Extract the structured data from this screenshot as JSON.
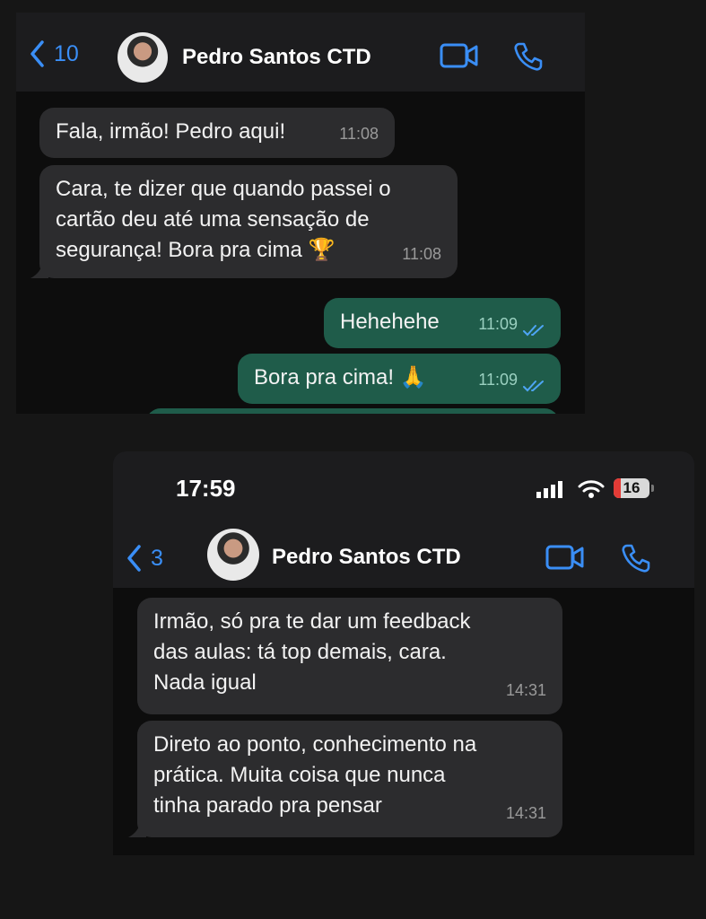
{
  "screenshot1": {
    "header": {
      "back_count": "10",
      "contact_name": "Pedro Santos CTD"
    },
    "messages": [
      {
        "direction": "incoming",
        "text": "Fala, irmão! Pedro aqui!",
        "time": "11:08"
      },
      {
        "direction": "incoming",
        "lines": [
          "Cara, te dizer que quando passei o",
          "cartão deu até uma sensação de",
          "segurança! Bora pra cima 🏆"
        ],
        "time": "11:08"
      },
      {
        "direction": "outgoing",
        "text": "Hehehehe",
        "time": "11:09",
        "status": "read"
      },
      {
        "direction": "outgoing",
        "text": "Bora pra cima! 🙏",
        "time": "11:09",
        "status": "read"
      }
    ]
  },
  "screenshot2": {
    "status_bar": {
      "time": "17:59",
      "battery": "16"
    },
    "header": {
      "back_count": "3",
      "contact_name": "Pedro Santos CTD"
    },
    "messages": [
      {
        "direction": "incoming",
        "lines": [
          "Irmão, só pra te dar um feedback",
          "das aulas: tá top demais, cara.",
          "Nada igual"
        ],
        "time": "14:31"
      },
      {
        "direction": "incoming",
        "lines": [
          "Direto ao ponto, conhecimento na",
          "prática. Muita coisa que nunca",
          "tinha parado pra pensar"
        ],
        "time": "14:31"
      }
    ]
  },
  "colors": {
    "accent_blue": "#3a8ef6",
    "incoming_bubble": "#2c2c2e",
    "outgoing_bubble": "#1f5c4a",
    "header_bg": "#1c1c1e"
  }
}
